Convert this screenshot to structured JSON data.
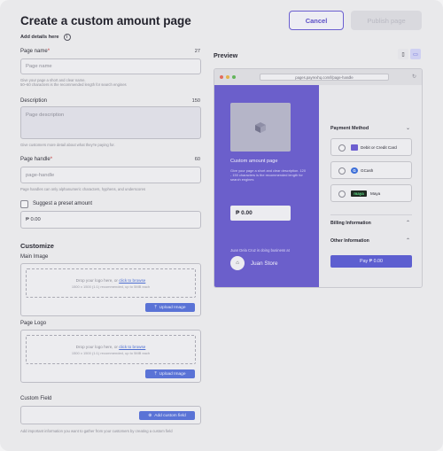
{
  "header": {
    "title": "Create a custom amount page",
    "cancel_label": "Cancel",
    "publish_label": "Publish page",
    "subtitle": "Add details here"
  },
  "form": {
    "page_name": {
      "label": "Page name",
      "required": "*",
      "count": "27",
      "placeholder": "Page name",
      "hint1": "Give your page a short and clear name.",
      "hint2": "50–60 characters is the recommended length for search engines"
    },
    "description": {
      "label": "Description",
      "count": "150",
      "placeholder": "Page description",
      "hint": "Give customers more detail about what they're paying for."
    },
    "page_handle": {
      "label": "Page handle",
      "required": "*",
      "count": "60",
      "placeholder": "page-handle",
      "hint": "Page handles can only alphanumeric characters, hyphens, and underscores"
    },
    "preset": {
      "label": "Suggest a preset amount",
      "value": "₱ 0.00"
    }
  },
  "customize": {
    "title": "Customize",
    "main_image": {
      "label": "Main Image",
      "drop_text": "Drop your logo here, or ",
      "browse": "click to browse",
      "rec": "1500 x 1500 (1:1) recommended, up to 5MB each",
      "button": "Upload Image"
    },
    "page_logo": {
      "label": "Page Logo",
      "drop_text": "Drop your logo here, or ",
      "browse": "click to browse",
      "rec": "1500 x 1500 (1:1) recommended, up to 5MB each",
      "button": "Upload Image"
    },
    "custom_field": {
      "label": "Custom Field",
      "button": "Add custom field",
      "hint": "Add important information you want to gather from your customers by creating a custom field"
    }
  },
  "preview": {
    "title": "Preview",
    "url": "pages.payrexhq.com/l/page-handle",
    "page_title": "Custom amount page",
    "page_desc": "Give your page a short and clear description. 120 - 150 characters is the recommended length for search engines",
    "amount": "₱ 0.00",
    "biz_line": "Juan Dela Cruz is doing business at",
    "store": "Juan Store",
    "payment_method": "Payment Method",
    "methods": [
      {
        "icon": "card-icon",
        "label": "Debit or Credit Card"
      },
      {
        "icon": "gcash-icon",
        "label": "GCash",
        "badge": "G"
      },
      {
        "icon": "maya-icon",
        "label": "Maya",
        "badge": "maya"
      }
    ],
    "billing": "Billing Information",
    "other": "Other Information",
    "pay_label": "Pay ₱ 0.00"
  },
  "colors": {
    "accent": "#6b5fcb",
    "button": "#5a73d6",
    "pay": "#5d5fd0"
  }
}
